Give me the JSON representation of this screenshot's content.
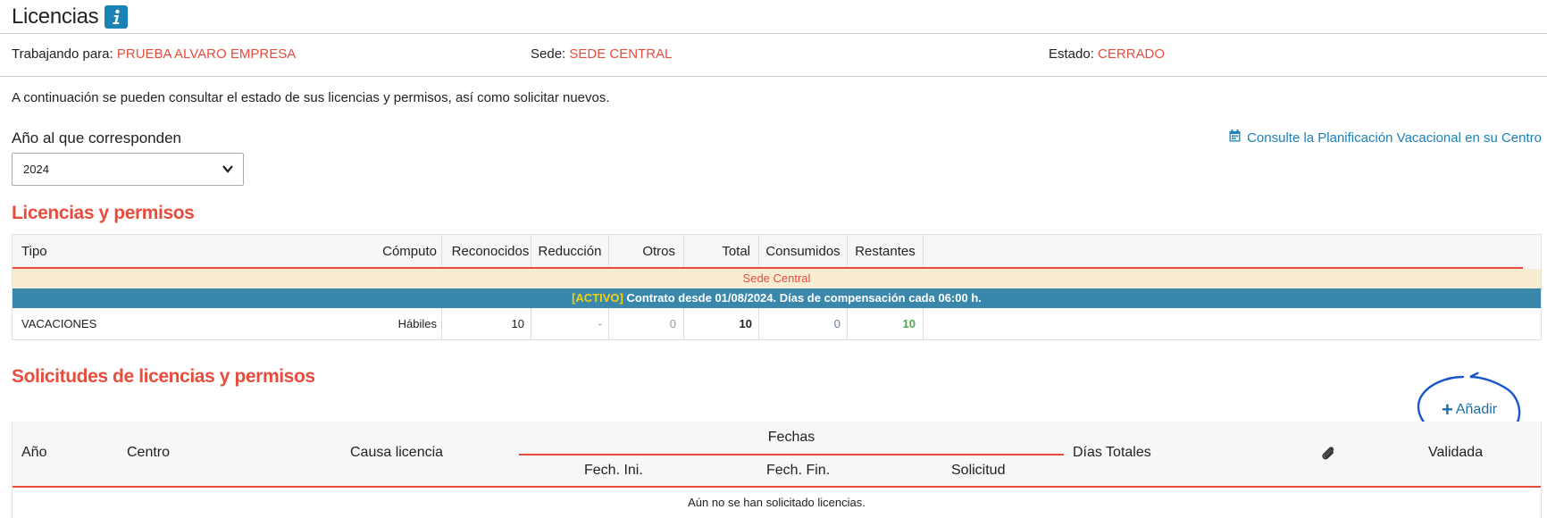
{
  "page": {
    "title": "Licencias",
    "info_icon": "info-icon"
  },
  "context": {
    "working_for_label": "Trabajando para:",
    "working_for_value": "PRUEBA ALVARO EMPRESA",
    "site_label": "Sede:",
    "site_value": "SEDE CENTRAL",
    "state_label": "Estado:",
    "state_value": "CERRADO"
  },
  "intro": "A continuación se pueden consultar el estado de sus licencias y permisos, así como solicitar nuevos.",
  "year_filter": {
    "label": "Año al que corresponden",
    "selected": "2024"
  },
  "planning_link": {
    "icon": "calendar-icon",
    "label": "Consulte la Planificación Vacacional en su Centro"
  },
  "licenses": {
    "title": "Licencias y permisos",
    "columns": [
      "Tipo",
      "Cómputo",
      "Reconocidos",
      "Reducción",
      "Otros",
      "Total",
      "Consumidos",
      "Restantes"
    ],
    "group": "Sede Central",
    "contract_tag": "[ACTIVO]",
    "contract_text": " Contrato desde 01/08/2024. Días de compensación cada 06:00 h.",
    "rows": [
      {
        "tipo": "VACACIONES",
        "computo": "Hábiles",
        "reconocidos": "10",
        "reduccion": "-",
        "otros": "0",
        "total": "10",
        "consumidos": "0",
        "restantes": "10"
      }
    ]
  },
  "requests": {
    "title": "Solicitudes de licencias y permisos",
    "add_label": "Añadir",
    "add_icon": "plus-icon",
    "columns": {
      "anio": "Año",
      "centro": "Centro",
      "causa": "Causa licencia",
      "fechas": "Fechas",
      "fech_ini": "Fech. Ini.",
      "fech_fin": "Fech. Fin.",
      "solicitud": "Solicitud",
      "dias_totales": "Días Totales",
      "adjunto_icon": "paperclip-icon",
      "validada": "Validada"
    },
    "empty_message": "Aún no se han solicitado licencias."
  }
}
